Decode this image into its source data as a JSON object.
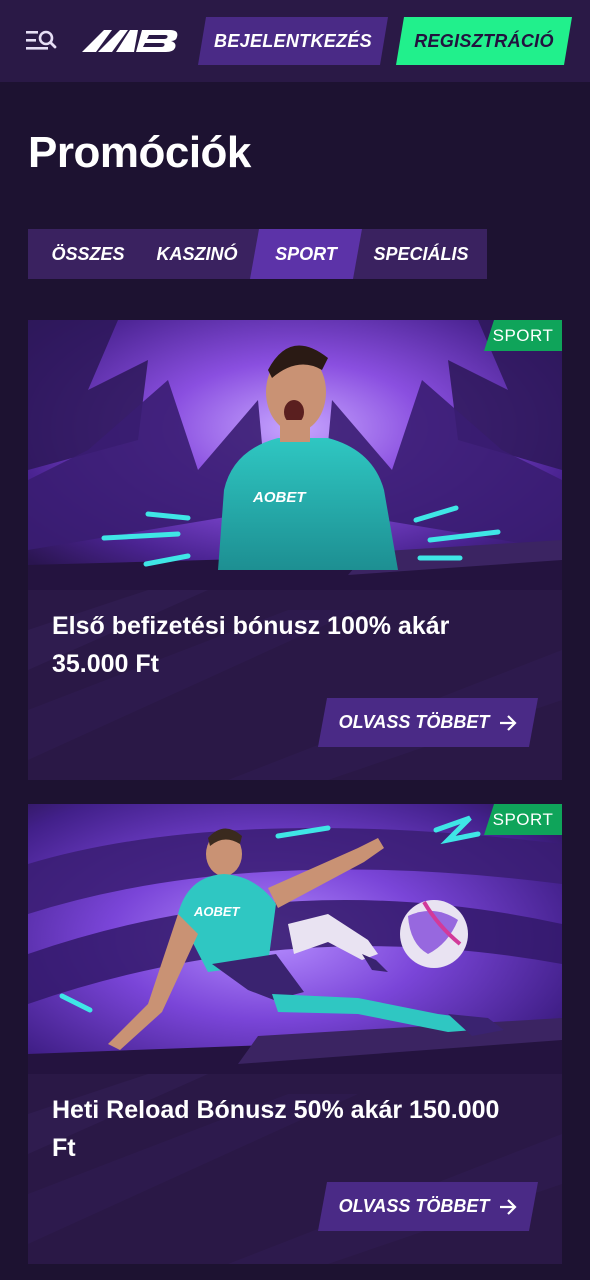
{
  "header": {
    "login_label": "BEJELENTKEZÉS",
    "register_label": "REGISZTRÁCIÓ",
    "menu_icon": "menu-search-icon",
    "logo_icon": "brand-logo-icon"
  },
  "page": {
    "title": "Promóciók"
  },
  "tabs": [
    {
      "label": "ÖSSZES",
      "active": false
    },
    {
      "label": "KASZINÓ",
      "active": false
    },
    {
      "label": "SPORT",
      "active": true
    },
    {
      "label": "SPECIÁLIS",
      "active": false
    }
  ],
  "promotions": [
    {
      "badge": "SPORT",
      "title": "Első befizetési bónusz 100% akár 35.000 Ft",
      "button_label": "OLVASS TÖBBET"
    },
    {
      "badge": "SPORT",
      "title": "Heti Reload Bónusz 50% akár 150.000 Ft",
      "button_label": "OLVASS TÖBBET"
    }
  ],
  "colors": {
    "background": "#1d1231",
    "header": "#2a1946",
    "accent_green": "#21f08c",
    "accent_purple": "#4a2a86",
    "tab_active": "#5c33a8",
    "badge": "#0fa45a"
  }
}
